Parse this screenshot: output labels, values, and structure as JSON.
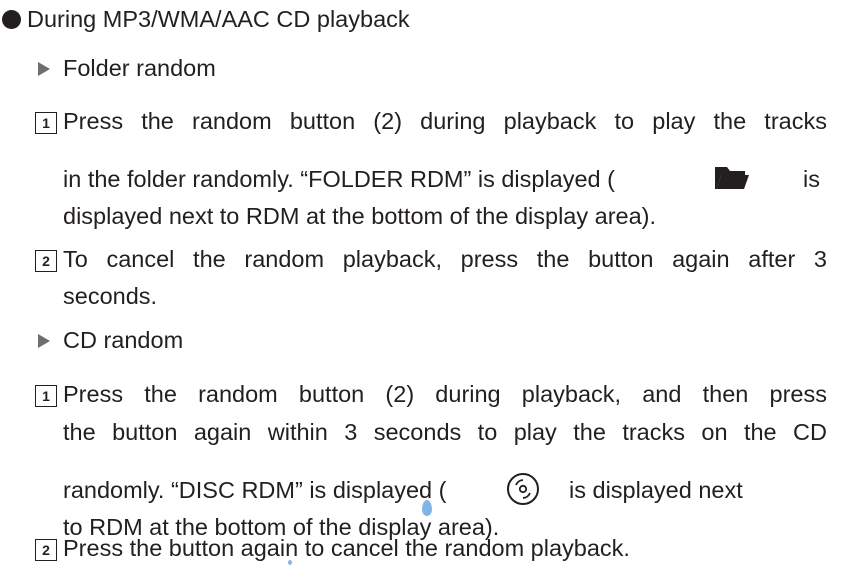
{
  "heading": {
    "text": "During MP3/WMA/AAC CD playback"
  },
  "sections": [
    {
      "title": "Folder random",
      "steps": [
        {
          "number": "1",
          "line1": "Press the random button (2) during playback to play the tracks",
          "line2_pre": "in the folder randomly. “FOLDER RDM” is displayed (",
          "line2_icon": "folder-icon",
          "line2_post": "is",
          "line3": "displayed next to RDM at the bottom of the display area)."
        },
        {
          "number": "2",
          "line1": "To cancel the random playback, press the button again after 3",
          "line2": "seconds."
        }
      ]
    },
    {
      "title": "CD random",
      "steps": [
        {
          "number": "1",
          "line1": "Press the random button (2) during playback, and then press",
          "line2": "the button again within 3 seconds to play the tracks on the CD",
          "line3_pre": "randomly. “DISC RDM” is displayed (",
          "line3_icon": "disc-icon",
          "line3_post": "is displayed next",
          "line4": "to RDM at the bottom of the display area)."
        },
        {
          "number": "2",
          "line1": "Press the button again to cancel the random playback."
        }
      ]
    }
  ],
  "colors": {
    "text": "#231f20",
    "marker": "#6d6e71",
    "accent": "#6aa8e0"
  }
}
